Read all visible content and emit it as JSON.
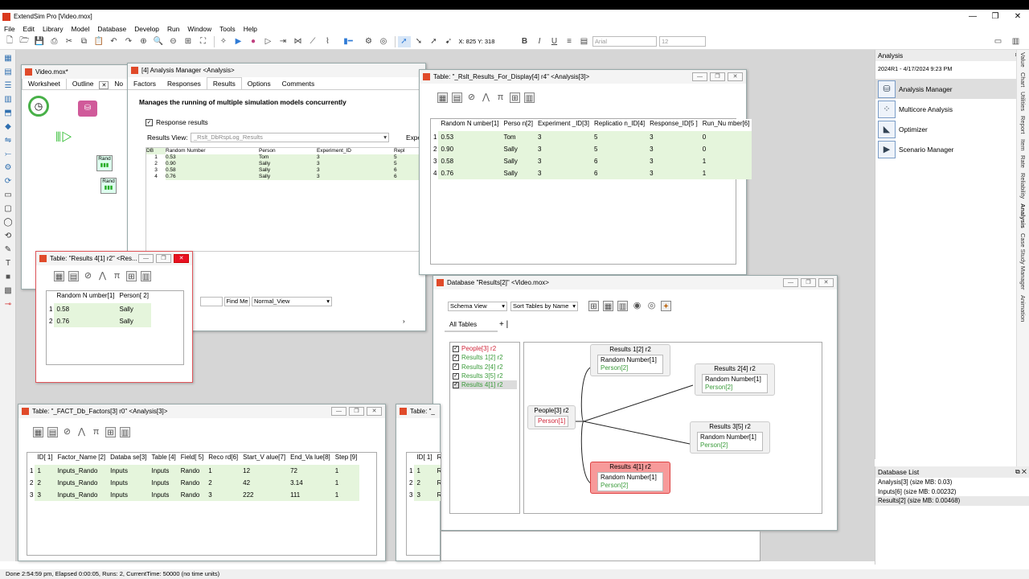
{
  "app": {
    "title": "ExtendSim Pro  [Video.mox]"
  },
  "menu": [
    "File",
    "Edit",
    "Library",
    "Model",
    "Database",
    "Develop",
    "Run",
    "Window",
    "Tools",
    "Help"
  ],
  "toolbar": {
    "coords": "X: 825 Y:  318",
    "font": "Arial",
    "size": "12"
  },
  "model_window": {
    "title": "Video.mox*",
    "tabs": [
      "Worksheet",
      "Outline",
      "No"
    ],
    "block_labels": [
      "Rand",
      "Rand"
    ]
  },
  "analysis_manager": {
    "title": "[4] Analysis Manager <Analysis>",
    "tabs": [
      "Factors",
      "Responses",
      "Results",
      "Options",
      "Comments"
    ],
    "active_tab": "Results",
    "description": "Manages the running of multiple simulation models concurrently",
    "checkbox": "Response results",
    "results_view_label": "Results View:",
    "results_view_value": "_Rslt_DbRspLog_Results",
    "expe": "Expe",
    "find_me": "Find Me",
    "view_select": "Normal_View",
    "mini_headers": [
      "DB",
      "Random Number",
      "Person",
      "Experiment_ID",
      "Repl"
    ],
    "mini_rows": [
      [
        "1",
        "0.53",
        "Tom",
        "3",
        "5"
      ],
      [
        "2",
        "0.90",
        "Sally",
        "3",
        "5"
      ],
      [
        "3",
        "0.58",
        "Sally",
        "3",
        "6"
      ],
      [
        "4",
        "0.76",
        "Sally",
        "3",
        "6"
      ]
    ]
  },
  "table_rslt": {
    "title": "Table: \"_Rslt_Results_For_Display[4]  r4\" <Analysis[3]>",
    "headers": [
      "Random N umber[1]",
      "Perso n[2]",
      "Experiment _ID[3]",
      "Replicatio n_ID[4]",
      "Response_ID[5 ]",
      "Run_Nu mber[6]"
    ],
    "rows": [
      [
        "1",
        "0.53",
        "Tom",
        "3",
        "5",
        "3",
        "0"
      ],
      [
        "2",
        "0.90",
        "Sally",
        "3",
        "5",
        "3",
        "0"
      ],
      [
        "3",
        "0.58",
        "Sally",
        "3",
        "6",
        "3",
        "1"
      ],
      [
        "4",
        "0.76",
        "Sally",
        "3",
        "6",
        "3",
        "1"
      ]
    ]
  },
  "table_results4": {
    "title": "Table: \"Results 4[1]  r2\" <Res...",
    "headers": [
      "Random N umber[1]",
      "Person[ 2]"
    ],
    "rows": [
      [
        "1",
        "0.58",
        "Sally"
      ],
      [
        "2",
        "0.76",
        "Sally"
      ]
    ]
  },
  "table_factors": {
    "title": "Table: \"_FACT_Db_Factors[3]  r0\" <Analysis[3]>",
    "headers": [
      "ID[ 1]",
      "Factor_Name [2]",
      "Databa se[3]",
      "Table [4]",
      "Field[ 5]",
      "Reco rd[6]",
      "Start_V alue[7]",
      "End_Va lue[8]",
      "Step [9]"
    ],
    "rows": [
      [
        "1",
        "1",
        "Inputs_Rando",
        "Inputs",
        "Inputs",
        "Rando",
        "1",
        "12",
        "72",
        "1"
      ],
      [
        "2",
        "2",
        "Inputs_Rando",
        "Inputs",
        "Inputs",
        "Rando",
        "2",
        "42",
        "3.14",
        "1"
      ],
      [
        "3",
        "3",
        "Inputs_Rando",
        "Inputs",
        "Inputs",
        "Rando",
        "3",
        "222",
        "111",
        "1"
      ]
    ]
  },
  "table_partial": {
    "title": "Table: \"_",
    "headers": [
      "ID[ 1]",
      "R"
    ],
    "rows": [
      [
        "1",
        "1",
        "R"
      ],
      [
        "2",
        "2",
        "R"
      ],
      [
        "3",
        "3",
        "R"
      ]
    ]
  },
  "database": {
    "title": "Database \"Results[2]\" <Video.mox>",
    "view": "Schema View",
    "sort": "Sort Tables by Name",
    "all_tables": "All Tables",
    "tables": [
      {
        "label": "People[3]  r2",
        "color": "#d0263a"
      },
      {
        "label": "Results 1[2]  r2",
        "color": "#3a9b3a"
      },
      {
        "label": "Results 2[4]  r2",
        "color": "#3a9b3a"
      },
      {
        "label": "Results 3[5]  r2",
        "color": "#3a9b3a"
      },
      {
        "label": "Results 4[1]  r2",
        "color": "#3a9b3a"
      }
    ],
    "nodes": {
      "people": {
        "title": "People[3]  r2",
        "field": "Person[1]"
      },
      "r1": {
        "title": "Results 1[2]  r2",
        "f1": "Random Number[1]",
        "f2": "Person[2]"
      },
      "r2": {
        "title": "Results 2[4]  r2",
        "f1": "Random Number[1]",
        "f2": "Person[2]"
      },
      "r3": {
        "title": "Results 3[5]  r2",
        "f1": "Random Number[1]",
        "f2": "Person[2]"
      },
      "r4": {
        "title": "Results 4[1]  r2",
        "f1": "Random Number[1]",
        "f2": "Person[2]"
      }
    }
  },
  "analysis_panel": {
    "title": "Analysis",
    "version": "2024R1 - 4/17/2024 9:23 PM",
    "items": [
      "Analysis Manager",
      "Multicore Analysis",
      "Optimizer",
      "Scenario Manager"
    ]
  },
  "vertical_tabs": [
    "Value",
    "Chart",
    "Utilities",
    "Report",
    "Item",
    "Rate",
    "Reliability",
    "Analysis",
    "Case Study Manager",
    "Animation"
  ],
  "database_list": {
    "title": "Database List",
    "items": [
      "Analysis[3]   (size MB: 0.03)",
      "Inputs[6]   (size MB: 0.00232)",
      "Results[2]   (size MB: 0.00468)"
    ]
  },
  "status": "Done 2:54:59 pm, Elapsed 0:00:05, Runs: 2, CurrentTime: 50000 (no time units)"
}
